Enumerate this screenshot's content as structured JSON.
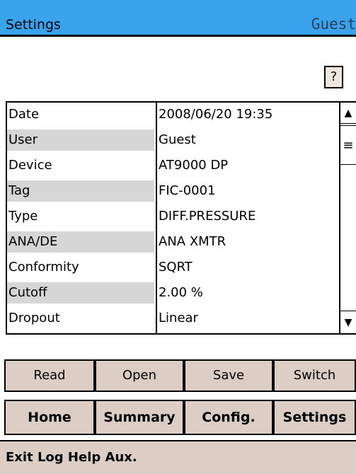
{
  "header": {
    "title": "Settings",
    "user": "Guest"
  },
  "help_label": "?",
  "rows": [
    {
      "name": "Date",
      "value": "2008/06/20 19:35"
    },
    {
      "name": "User",
      "value": "Guest"
    },
    {
      "name": "Device",
      "value": "AT9000 DP"
    },
    {
      "name": "Tag",
      "value": "FIC-0001"
    },
    {
      "name": "Type",
      "value": "DIFF.PRESSURE"
    },
    {
      "name": "ANA/DE",
      "value": "ANA XMTR"
    },
    {
      "name": "Conformity",
      "value": "SQRT"
    },
    {
      "name": "Cutoff",
      "value": "2.00 %"
    },
    {
      "name": "Dropout",
      "value": "Linear"
    }
  ],
  "scrollbar": {
    "up": "▲",
    "thumb": "≡",
    "down": "▼"
  },
  "actions": {
    "read": "Read",
    "open": "Open",
    "save": "Save",
    "switch": "Switch"
  },
  "nav": {
    "home": "Home",
    "summary": "Summary",
    "config": "Config.",
    "settings": "Settings"
  },
  "menu": "Exit Log Help Aux.",
  "colors": {
    "titlebar": "#3aa3ee",
    "button": "#dccdc5",
    "row_shade": "#d6d6d6"
  }
}
